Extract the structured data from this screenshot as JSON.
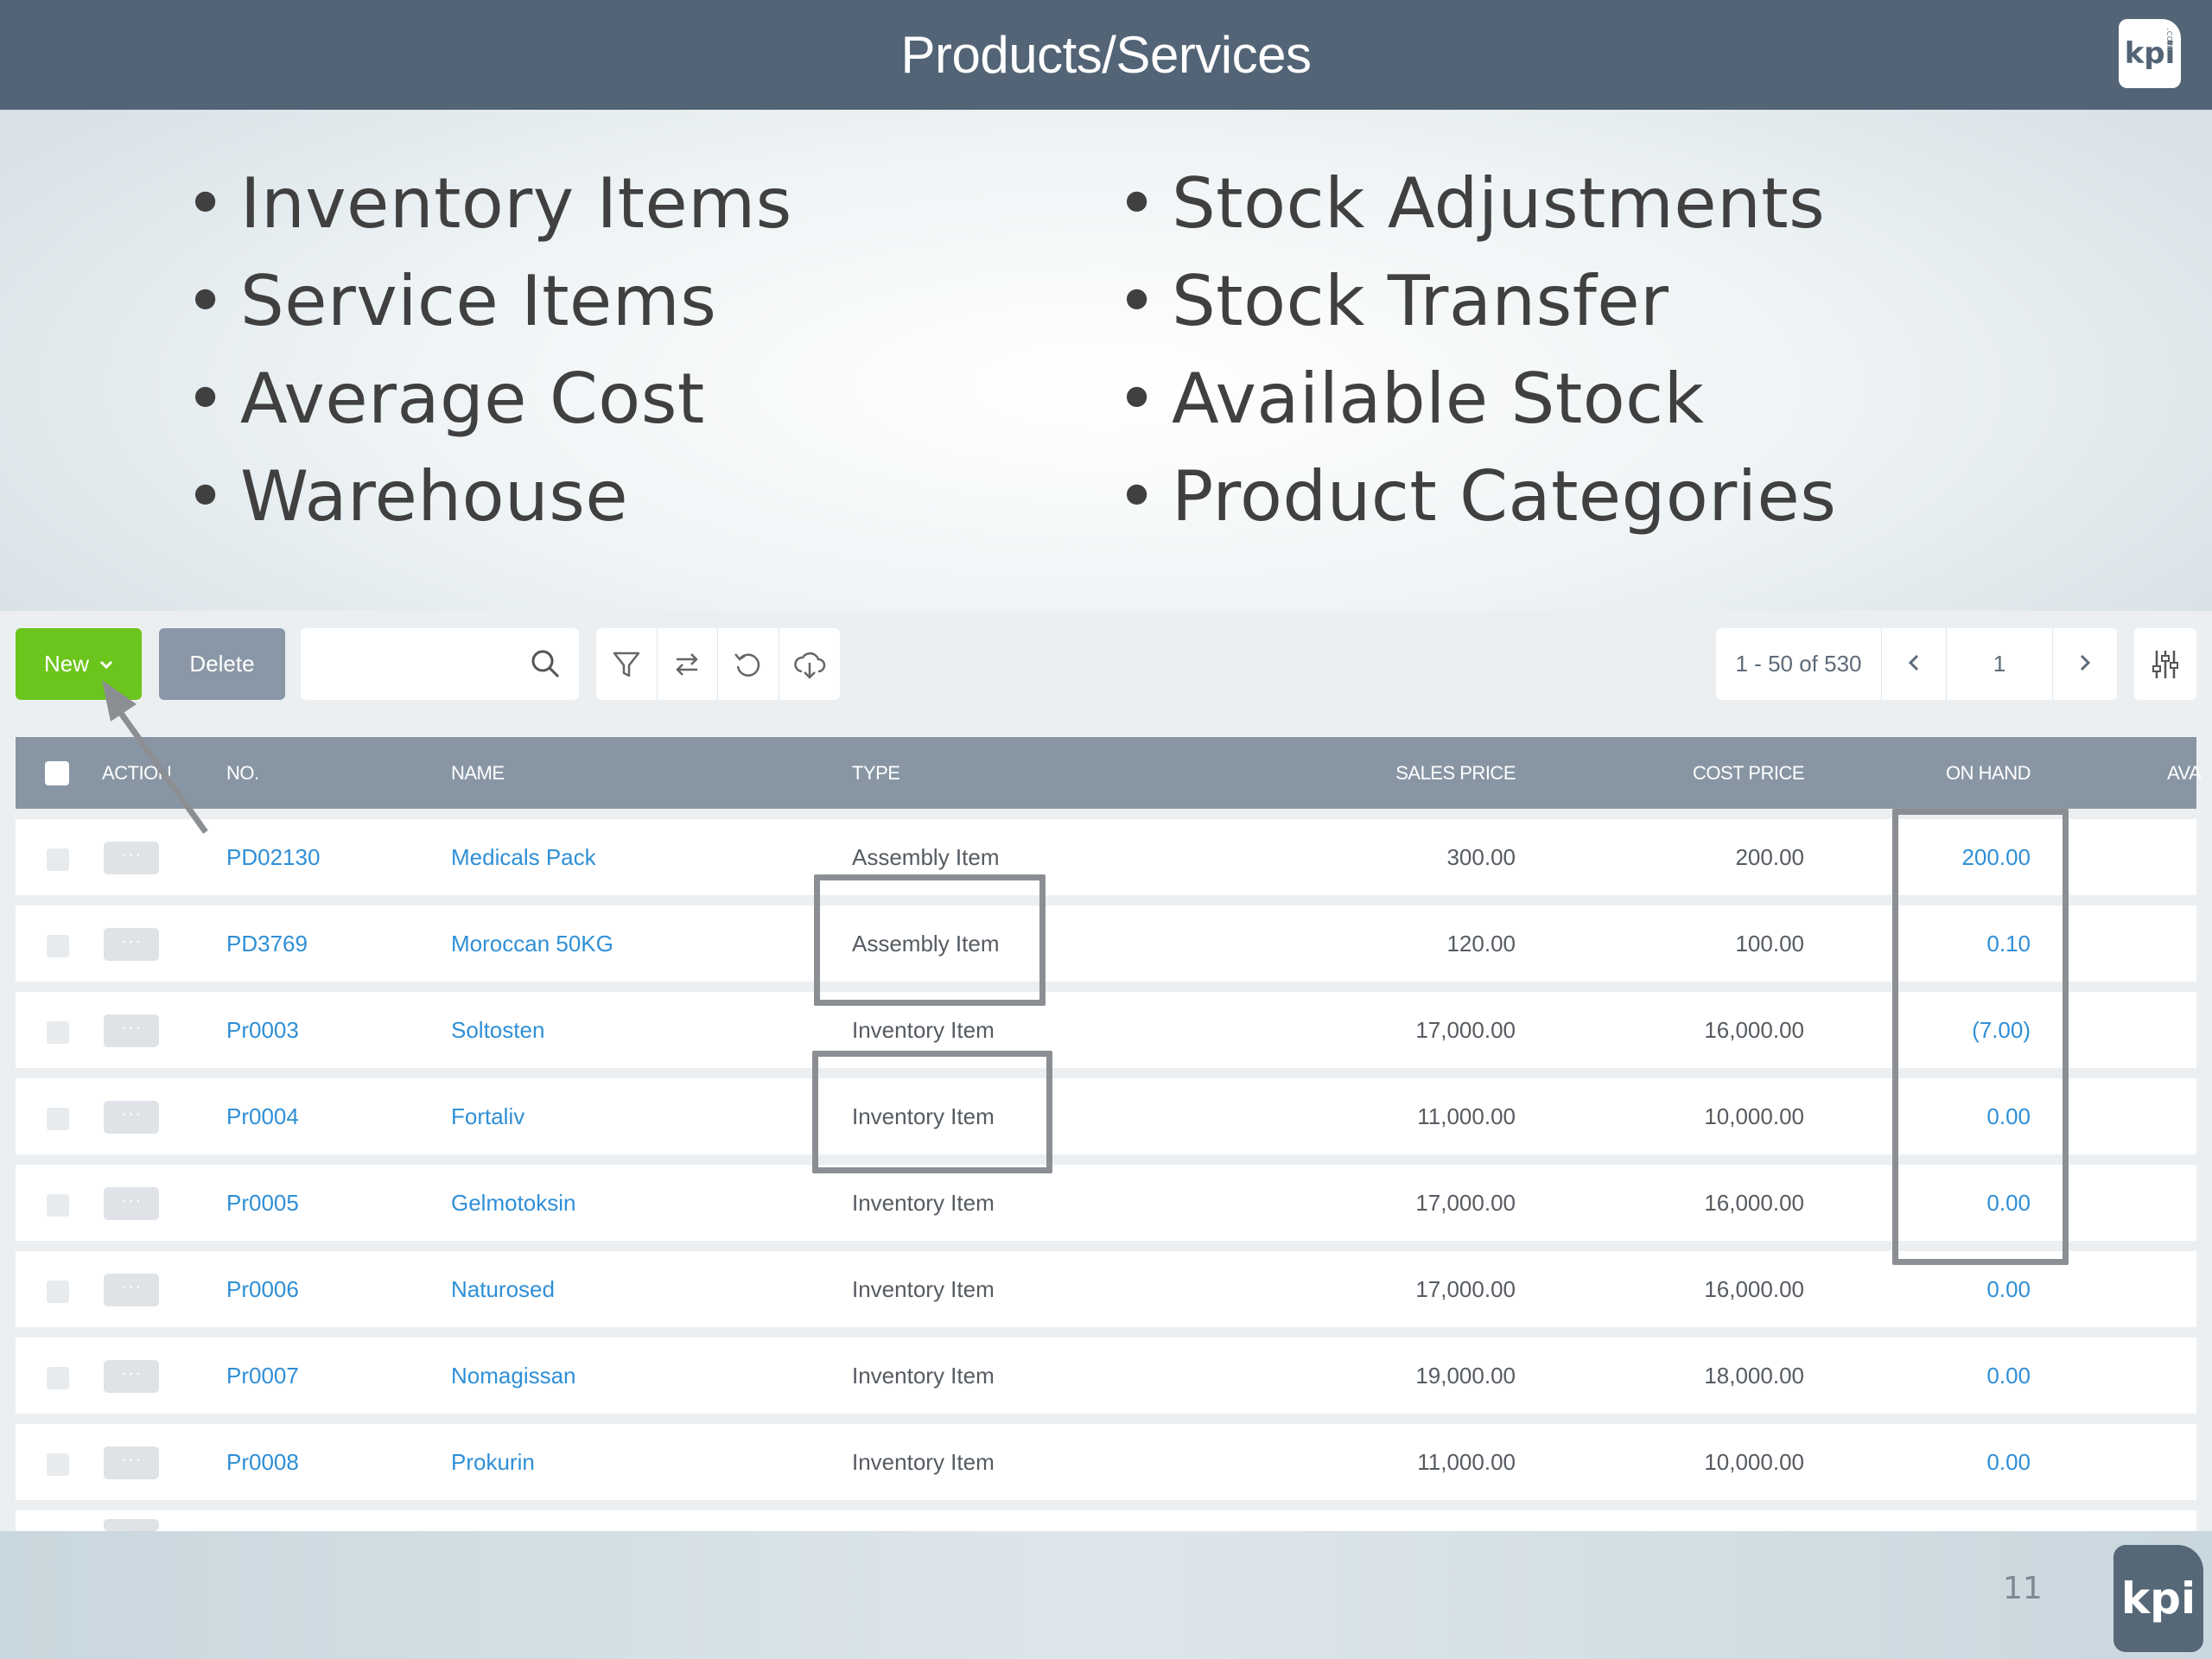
{
  "slide": {
    "title": "Products/Services",
    "logo_text": "kpi",
    "logo_suffix": ".com",
    "bullets_left": [
      "Inventory Items",
      "Service Items",
      "Average Cost",
      "Warehouse"
    ],
    "bullets_right": [
      "Stock Adjustments",
      "Stock Transfer",
      "Available Stock",
      "Product Categories"
    ],
    "page_number": "11",
    "footer_logo_text": "kpi"
  },
  "toolbar": {
    "new_label": "New",
    "delete_label": "Delete",
    "search_value": "",
    "pagination_range": "1 - 50 of 530",
    "current_page": "1"
  },
  "table": {
    "columns": {
      "action": "ACTION",
      "no": "NO.",
      "name": "NAME",
      "type": "TYPE",
      "sales_price": "SALES PRICE",
      "cost_price": "COST PRICE",
      "on_hand": "ON HAND",
      "available": "AVA"
    },
    "rows": [
      {
        "no": "PD02130",
        "name": "Medicals Pack",
        "type": "Assembly Item",
        "sales": "300.00",
        "cost": "200.00",
        "on_hand": "200.00"
      },
      {
        "no": "PD3769",
        "name": "Moroccan 50KG",
        "type": "Assembly Item",
        "sales": "120.00",
        "cost": "100.00",
        "on_hand": "0.10"
      },
      {
        "no": "Pr0003",
        "name": "Soltosten",
        "type": "Inventory Item",
        "sales": "17,000.00",
        "cost": "16,000.00",
        "on_hand": "(7.00)"
      },
      {
        "no": "Pr0004",
        "name": "Fortaliv",
        "type": "Inventory Item",
        "sales": "11,000.00",
        "cost": "10,000.00",
        "on_hand": "0.00"
      },
      {
        "no": "Pr0005",
        "name": "Gelmotoksin",
        "type": "Inventory Item",
        "sales": "17,000.00",
        "cost": "16,000.00",
        "on_hand": "0.00"
      },
      {
        "no": "Pr0006",
        "name": "Naturosed",
        "type": "Inventory Item",
        "sales": "17,000.00",
        "cost": "16,000.00",
        "on_hand": "0.00"
      },
      {
        "no": "Pr0007",
        "name": "Nomagissan",
        "type": "Inventory Item",
        "sales": "19,000.00",
        "cost": "18,000.00",
        "on_hand": "0.00"
      },
      {
        "no": "Pr0008",
        "name": "Prokurin",
        "type": "Inventory Item",
        "sales": "11,000.00",
        "cost": "10,000.00",
        "on_hand": "0.00"
      }
    ]
  },
  "colors": {
    "title_bar": "#526475",
    "new_button": "#6cc51c",
    "delete_button": "#8a97a6",
    "table_header": "#8896a4",
    "link": "#2f8fd6",
    "highlight_box": "#8b8f93"
  },
  "icons": {
    "search": "search-icon",
    "filter": "filter-icon",
    "transfer": "swap-icon",
    "refresh": "refresh-icon",
    "export": "cloud-download-icon",
    "prev": "chevron-left-icon",
    "next": "chevron-right-icon",
    "settings": "column-settings-icon"
  }
}
